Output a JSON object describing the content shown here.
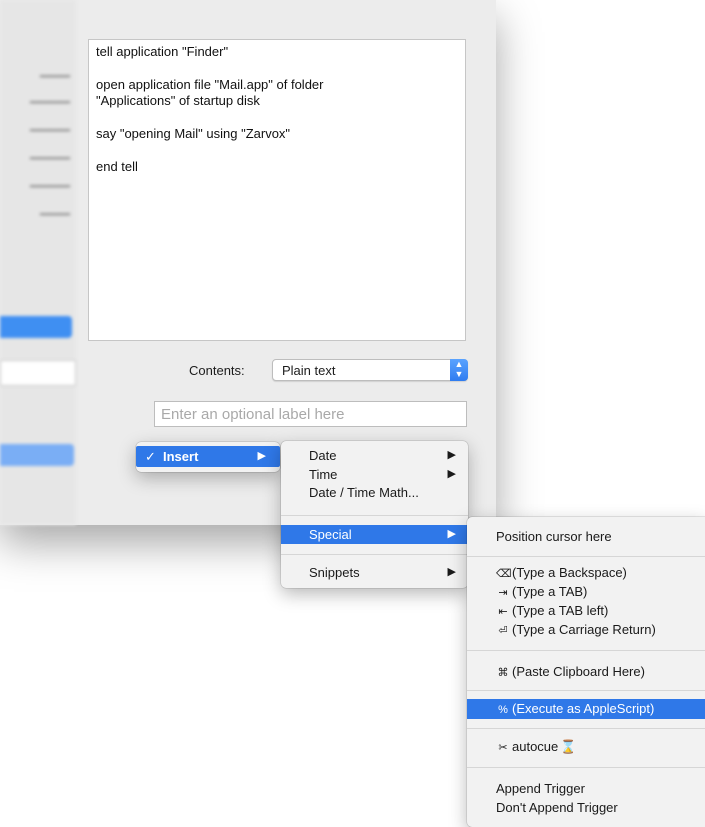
{
  "editor": {
    "lines": [
      "tell application \"Finder\"",
      "open application file \"Mail.app\" of folder\n\"Applications\" of startup disk",
      "say \"opening Mail\" using \"Zarvox\"",
      "end tell"
    ]
  },
  "contents": {
    "label": "Contents:",
    "value": "Plain text"
  },
  "label_field": {
    "placeholder": "Enter an optional label here",
    "value": ""
  },
  "menu_insert": {
    "check": "✓",
    "label": "Insert",
    "arrow": "▶"
  },
  "menu_main": {
    "date": "Date",
    "time": "Time",
    "date_time_math": "Date / Time Math...",
    "special": "Special",
    "snippets": "Snippets",
    "arrow": "▶"
  },
  "menu_special": {
    "position_cursor": "Position cursor here",
    "backspace_icon": "⌫",
    "backspace": "(Type a Backspace)",
    "tab_icon": "⇥",
    "tab": "(Type a TAB)",
    "tab_left_icon": "⇤",
    "tab_left": "(Type a TAB left)",
    "return_icon": "⏎",
    "carriage_return": "(Type a Carriage Return)",
    "clipboard_icon": "⌘",
    "paste_clipboard": "(Paste Clipboard Here)",
    "applescript_icon": "%",
    "execute_applescript": "(Execute as AppleScript)",
    "autocue_icon": "✂",
    "autocue": "autocue",
    "hourglass_icon": "⌛",
    "append_trigger": "Append Trigger",
    "dont_append_trigger": "Don't Append Trigger"
  },
  "colors": {
    "accent": "#2f78e8",
    "hourglass": "#c0392b"
  }
}
